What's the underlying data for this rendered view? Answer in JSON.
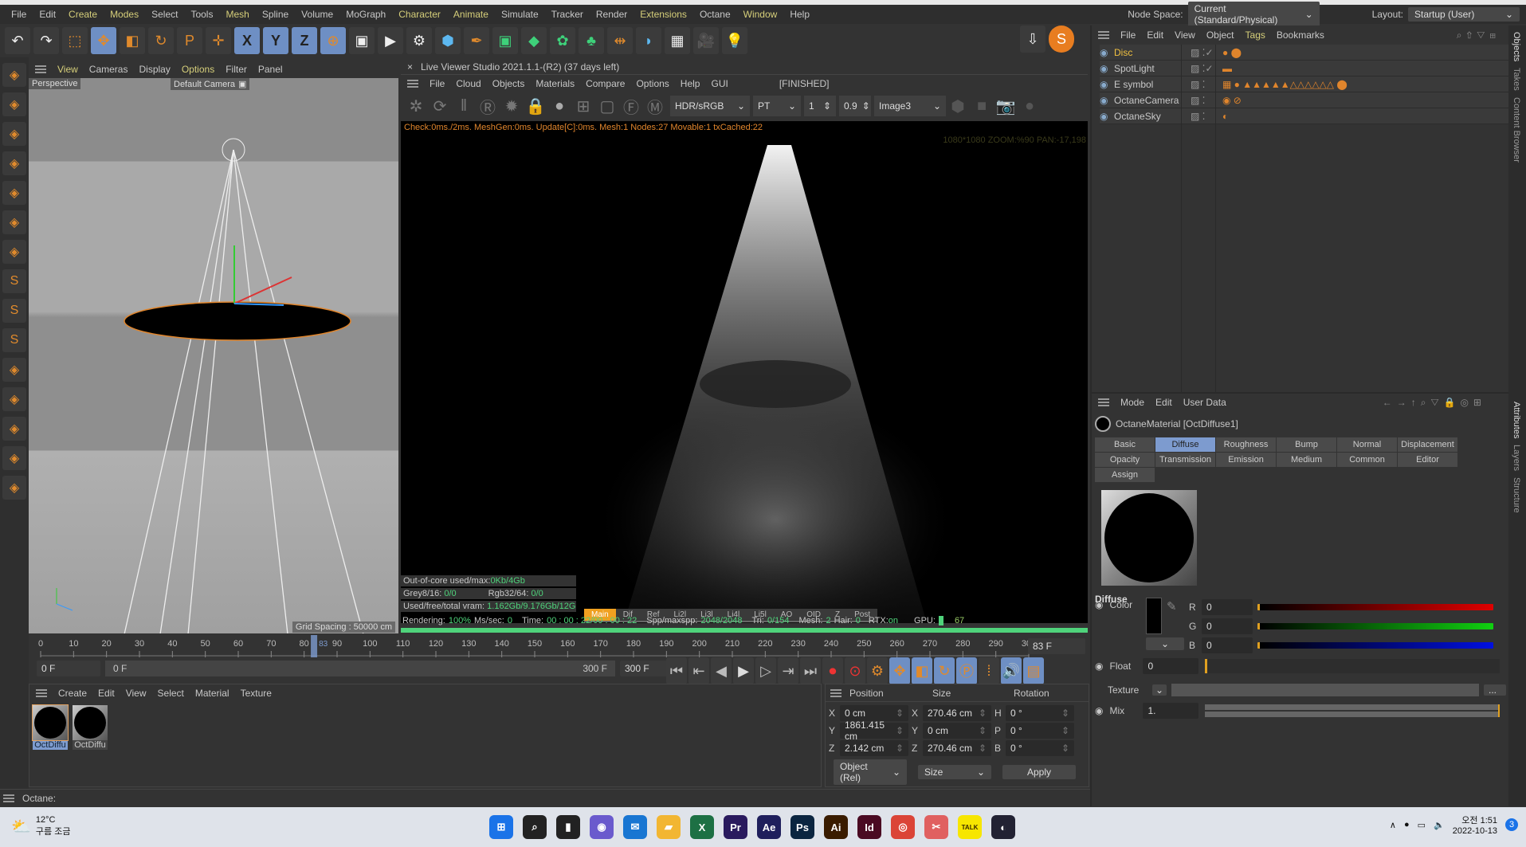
{
  "menubar": {
    "items": [
      "File",
      "Edit",
      "Create",
      "Modes",
      "Select",
      "Tools",
      "Mesh",
      "Spline",
      "Volume",
      "MoGraph",
      "Character",
      "Animate",
      "Simulate",
      "Tracker",
      "Render",
      "Extensions",
      "Octane",
      "Window",
      "Help"
    ],
    "highlighted": [
      "Create",
      "Modes",
      "Mesh",
      "Character",
      "Animate",
      "Extensions",
      "Window"
    ],
    "node_space_label": "Node Space:",
    "node_space_value": "Current (Standard/Physical)",
    "layout_label": "Layout:",
    "layout_value": "Startup (User)"
  },
  "toolbar": {
    "icons": [
      "undo-icon",
      "redo-icon",
      "live-selection-icon",
      "move-icon",
      "scale-icon",
      "rotate-icon",
      "psr-icon",
      "world-axis-icon",
      "x-axis-icon",
      "y-axis-icon",
      "z-axis-icon",
      "coordinate-system-icon",
      "render-view-icon",
      "render-icon",
      "render-settings-icon",
      "cube-icon",
      "pen-icon",
      "subdivision-icon",
      "extrude-icon",
      "cloner-icon",
      "mograph-icon",
      "symmetry-icon",
      "deformer-icon",
      "floor-icon",
      "camera-icon",
      "light-icon"
    ],
    "x_label": "X",
    "y_label": "Y",
    "z_label": "Z"
  },
  "viewport": {
    "menu": [
      "View",
      "Cameras",
      "Display",
      "Options",
      "Filter",
      "Panel"
    ],
    "projection": "Perspective",
    "camera": "Default Camera",
    "grid_spacing": "Grid Spacing : 50000 cm"
  },
  "live_viewer": {
    "title": "Live Viewer Studio 2021.1.1-(R2) (37 days left)",
    "menu": [
      "File",
      "Cloud",
      "Objects",
      "Materials",
      "Compare",
      "Options",
      "Help",
      "GUI"
    ],
    "state": "[FINISHED]",
    "color_space": "HDR/sRGB",
    "kernel": "PT",
    "value1": "1",
    "value2": "0.9",
    "image": "Image3",
    "check_line": "Check:0ms./2ms. MeshGen:0ms. Update[C]:0ms. Mesh:1 Nodes:27 Movable:1 txCached:22",
    "zoom_info": "1080*1080 ZOOM:%90  PAN:-17,198",
    "out_of_core_label": "Out-of-core used/max:",
    "out_of_core": "0Kb/4Gb",
    "grey_label": "Grey8/16:",
    "grey": "0/0",
    "rgb_label": "Rgb32/64:",
    "rgb": "0/0",
    "vram_label": "Used/free/total vram:",
    "vram": "1.162Gb/9.176Gb/12Gb",
    "passes": [
      "Main",
      "Dif",
      "Ref",
      "Li2l",
      "Li3l",
      "Li4l",
      "Li5l",
      "AO",
      "OID",
      "Z",
      "Post"
    ],
    "active_pass": "Main",
    "stats": {
      "rendering_label": "Rendering:",
      "rendering": "100%",
      "mssec_label": "Ms/sec:",
      "mssec": "0",
      "time_label": "Time:",
      "time": "00 : 00 : 22/00 : 00 : 22",
      "spp_label": "Spp/maxspp:",
      "spp": "2048/2048",
      "tri_label": "Tri:",
      "tri": "0/154",
      "mesh_label": "Mesh:",
      "mesh": "2",
      "hair_label": "Hair:",
      "hair": "0",
      "rtx_label": "RTX:",
      "rtx": "on",
      "gpu_label": "GPU:",
      "gpu": "67"
    },
    "progress": 1.0
  },
  "timeline": {
    "start": 0,
    "end": 300,
    "step": 10,
    "current": 83,
    "current_field": "83 F",
    "start_field": "0 F",
    "range_start": "0 F",
    "range_end": "300 F",
    "end_field": "300 F"
  },
  "material_manager": {
    "menu": [
      "Create",
      "Edit",
      "View",
      "Select",
      "Material",
      "Texture"
    ],
    "materials": [
      {
        "name": "OctDiffu",
        "selected": true
      },
      {
        "name": "OctDiffu",
        "selected": false
      }
    ]
  },
  "coordinates": {
    "headers": [
      "Position",
      "Size",
      "Rotation"
    ],
    "rows": [
      {
        "pl": "X",
        "p": "0 cm",
        "sl": "X",
        "s": "270.46 cm",
        "rl": "H",
        "r": "0 °"
      },
      {
        "pl": "Y",
        "p": "1861.415 cm",
        "sl": "Y",
        "s": "0 cm",
        "rl": "P",
        "r": "0 °"
      },
      {
        "pl": "Z",
        "p": "2.142 cm",
        "sl": "Z",
        "s": "270.46 cm",
        "rl": "B",
        "r": "0 °"
      }
    ],
    "mode": "Object (Rel)",
    "size_mode": "Size",
    "apply": "Apply"
  },
  "status": {
    "text": "Octane:"
  },
  "objects": {
    "menu": [
      "File",
      "Edit",
      "View",
      "Object",
      "Tags",
      "Bookmarks"
    ],
    "items": [
      {
        "name": "Disc",
        "icon": "disc-icon",
        "selected": true
      },
      {
        "name": "SpotLight",
        "icon": "spotlight-icon"
      },
      {
        "name": "E symbol",
        "icon": "symbol-icon"
      },
      {
        "name": "OctaneCamera",
        "icon": "camera-icon"
      },
      {
        "name": "OctaneSky",
        "icon": "sky-icon"
      }
    ]
  },
  "attributes": {
    "menu": [
      "Mode",
      "Edit",
      "User Data"
    ],
    "title": "OctaneMaterial [OctDiffuse1]",
    "tabs": [
      "Basic",
      "Diffuse",
      "Roughness",
      "Bump",
      "Normal",
      "Displacement",
      "Opacity",
      "Transmission",
      "Emission",
      "Medium",
      "Common",
      "Editor",
      "Assign"
    ],
    "active_tab": "Diffuse",
    "section": "Diffuse",
    "color_label": "Color",
    "r_label": "R",
    "r": "0",
    "g_label": "G",
    "g": "0",
    "b_label": "B",
    "b": "0",
    "float_label": "Float",
    "float": "0",
    "texture_label": "Texture",
    "texture_btn": "...",
    "mix_label": "Mix",
    "mix": "1.",
    "mix_fraction": 1.0
  },
  "side_tabs": [
    "Objects",
    "Takes",
    "Content Browser",
    "Attributes",
    "Layers",
    "Structure"
  ],
  "taskbar": {
    "temp": "12°C",
    "weather": "구름 조금",
    "time": "오전 1:51",
    "date": "2022-10-13",
    "notifications": "3",
    "apps": [
      {
        "name": "start",
        "label": "⊞",
        "color": "#1a73e8"
      },
      {
        "name": "search",
        "label": "⌕",
        "color": "#222"
      },
      {
        "name": "task-view",
        "label": "▮",
        "color": "#222"
      },
      {
        "name": "chat",
        "label": "◉",
        "color": "#6a5acd"
      },
      {
        "name": "mail",
        "label": "✉",
        "color": "#1976d2"
      },
      {
        "name": "explorer",
        "label": "▰",
        "color": "#f2b632"
      },
      {
        "name": "excel",
        "label": "X",
        "color": "#1d7044"
      },
      {
        "name": "premiere",
        "label": "Pr",
        "color": "#2a1a5e"
      },
      {
        "name": "after-effects",
        "label": "Ae",
        "color": "#1f1f5c"
      },
      {
        "name": "photoshop",
        "label": "Ps",
        "color": "#0b2540"
      },
      {
        "name": "illustrator",
        "label": "Ai",
        "color": "#3a1c00"
      },
      {
        "name": "indesign",
        "label": "Id",
        "color": "#4a0a22"
      },
      {
        "name": "chrome",
        "label": "◎",
        "color": "#db4437"
      },
      {
        "name": "snipping",
        "label": "✂",
        "color": "#e06060"
      },
      {
        "name": "kakaotalk",
        "label": "TALK",
        "color": "#f7e600"
      },
      {
        "name": "cinema4d",
        "label": "◐",
        "color": "#223"
      }
    ]
  }
}
